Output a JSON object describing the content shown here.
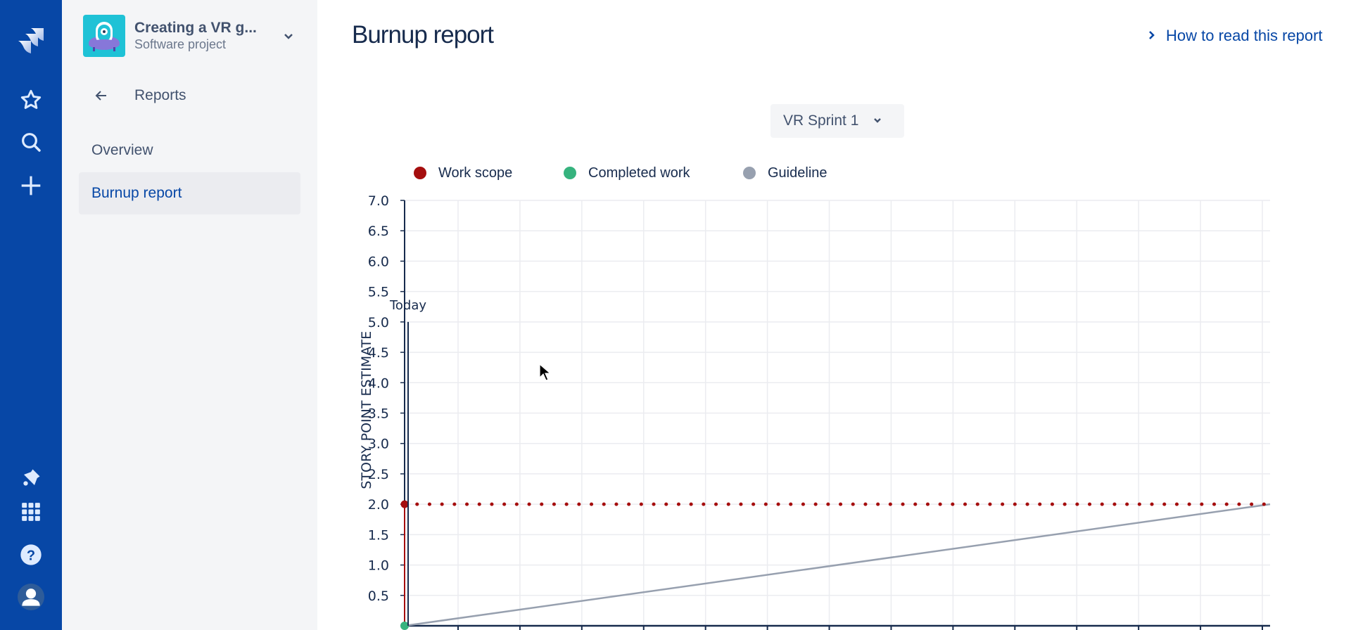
{
  "nav": {
    "items": [
      {
        "name": "jira-logo-icon"
      },
      {
        "name": "star-icon"
      },
      {
        "name": "search-icon"
      },
      {
        "name": "create-icon"
      },
      {
        "name": "notifications-icon"
      },
      {
        "name": "app-switcher-icon"
      },
      {
        "name": "help-icon"
      },
      {
        "name": "profile-avatar-icon"
      }
    ],
    "colors": {
      "background": "#0747A6",
      "icon": "#DEEBFF"
    }
  },
  "sidebar": {
    "project_name": "Creating a VR g...",
    "project_type": "Software project",
    "back_label": "Reports",
    "items": [
      {
        "label": "Overview",
        "active": false
      },
      {
        "label": "Burnup report",
        "active": true
      }
    ]
  },
  "main": {
    "title": "Burnup report",
    "help_link": "How to read this report",
    "sprint_select": "VR Sprint 1"
  },
  "chart_data": {
    "type": "line",
    "title": "",
    "xlabel": "",
    "ylabel": "STORY POINT ESTIMATE",
    "ylim": [
      0,
      7.0
    ],
    "yticks": [
      "0.5",
      "1.0",
      "1.5",
      "2.0",
      "2.5",
      "3.0",
      "3.5",
      "4.0",
      "4.5",
      "5.0",
      "5.5",
      "6.0",
      "6.5",
      "7.0"
    ],
    "x_intervals": 14,
    "grid": true,
    "legend_position": "top-left",
    "legend": [
      {
        "label": "Work scope",
        "color": "#A50E0E"
      },
      {
        "label": "Completed work",
        "color": "#36B37E"
      },
      {
        "label": "Guideline",
        "color": "#97A0AF"
      }
    ],
    "series": [
      {
        "name": "Work scope",
        "style": "dotted",
        "color": "#A50E0E",
        "points": [
          [
            0,
            0
          ],
          [
            0,
            2.0
          ],
          [
            1,
            2.0
          ]
        ]
      },
      {
        "name": "Completed work",
        "style": "solid",
        "color": "#36B37E",
        "points": [
          [
            0,
            0
          ]
        ]
      },
      {
        "name": "Guideline",
        "style": "solid",
        "color": "#97A0AF",
        "points": [
          [
            0,
            0
          ],
          [
            1,
            2.0
          ]
        ]
      }
    ],
    "annotations": [
      {
        "label": "Today",
        "x": 0.004,
        "y_top": 5.0
      }
    ]
  }
}
